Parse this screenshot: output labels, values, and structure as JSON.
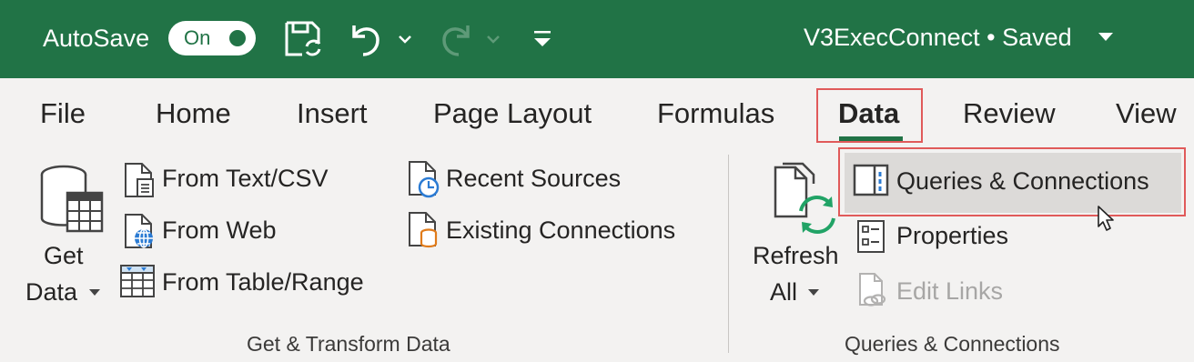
{
  "titlebar": {
    "autosave_label": "AutoSave",
    "autosave_state": "On",
    "document_title": "V3ExecConnect • Saved",
    "color": "#217346"
  },
  "tabs": [
    {
      "label": "File"
    },
    {
      "label": "Home"
    },
    {
      "label": "Insert"
    },
    {
      "label": "Page Layout"
    },
    {
      "label": "Formulas"
    },
    {
      "label": "Data",
      "active": true
    },
    {
      "label": "Review"
    },
    {
      "label": "View"
    }
  ],
  "groups": {
    "get_transform": {
      "label": "Get & Transform Data",
      "get_data": {
        "line1": "Get",
        "line2": "Data"
      },
      "from_text_csv": "From Text/CSV",
      "from_web": "From Web",
      "from_table_range": "From Table/Range",
      "recent_sources": "Recent Sources",
      "existing_connections": "Existing Connections"
    },
    "queries_connections": {
      "label": "Queries & Connections",
      "refresh_all": {
        "line1": "Refresh",
        "line2": "All"
      },
      "queries_connections_btn": "Queries & Connections",
      "properties": "Properties",
      "edit_links": "Edit Links"
    }
  },
  "icons": [
    "save-icon",
    "undo-icon",
    "redo-icon",
    "customize-qat-icon",
    "database-icon",
    "text-file-icon",
    "web-icon",
    "table-icon",
    "clock-file-icon",
    "connection-file-icon",
    "refresh-icon",
    "queries-pane-icon",
    "properties-icon",
    "edit-links-icon",
    "mouse-cursor-icon"
  ],
  "highlight_color": "#e05a5a"
}
